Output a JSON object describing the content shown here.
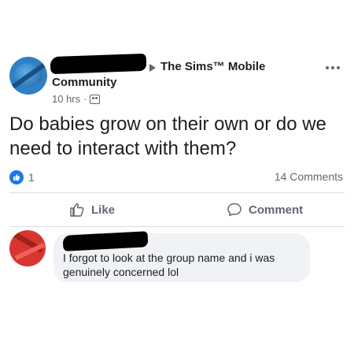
{
  "post": {
    "group_name": "The Sims™ Mobile",
    "group_name_line2": "Community",
    "time": "10 hrs",
    "separator": "·",
    "text": "Do babies grow on their own or do we need to interact with them?",
    "reaction_count": "1",
    "comments_count": "14 Comments"
  },
  "actions": {
    "like_label": "Like",
    "comment_label": "Comment"
  },
  "comment": {
    "text": "I forgot to look at the group name and i was genuinely concerned lol"
  },
  "icons": {
    "reaction": "like-icon",
    "group": "group-icon",
    "more": "more-icon"
  },
  "colors": {
    "like_blue": "#1877f2",
    "secondary_text": "#606770",
    "bubble_bg": "#f0f2f5"
  }
}
